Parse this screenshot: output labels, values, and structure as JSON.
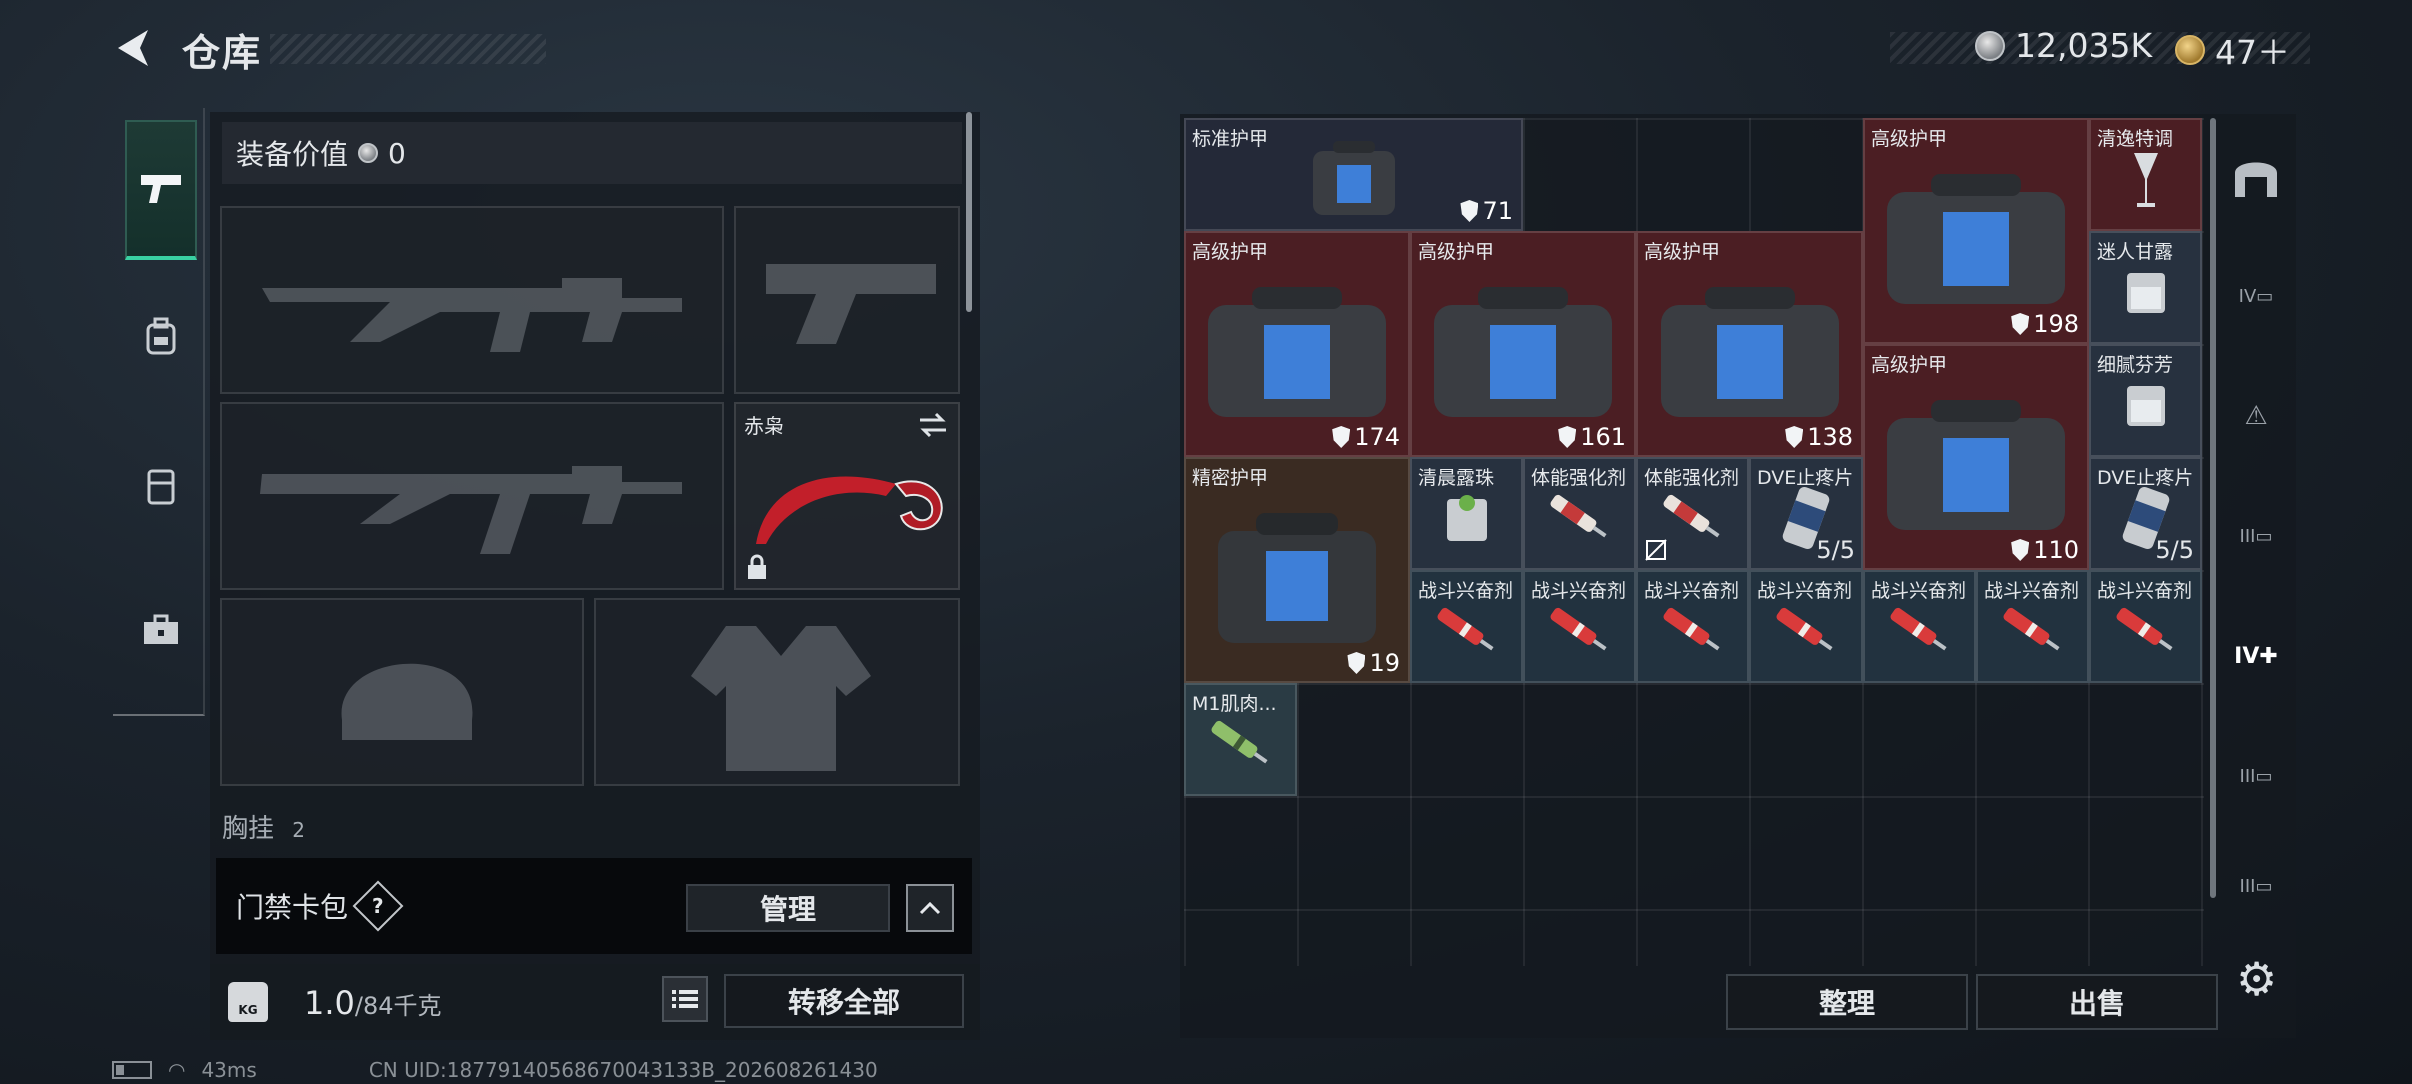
{
  "header": {
    "title": "仓库",
    "currency_silver": "12,035K",
    "currency_gold": "47＋"
  },
  "equipment": {
    "value_label": "装备价值",
    "value": "0",
    "melee_name": "赤枭",
    "chest_label": "胸挂",
    "chest_count": "2",
    "access_card_label": "门禁卡包",
    "help": "?",
    "manage_label": "管理",
    "weight_value": "1.0",
    "weight_max": "/84千克",
    "kg_label": "KG",
    "transfer_label": "转移全部"
  },
  "stash": {
    "items": [
      {
        "name": "标准护甲",
        "durability": "71"
      },
      {
        "name": "高级护甲",
        "durability": "198"
      },
      {
        "name": "清逸特调"
      },
      {
        "name": "高级护甲",
        "durability": "174"
      },
      {
        "name": "高级护甲",
        "durability": "161"
      },
      {
        "name": "高级护甲",
        "durability": "138"
      },
      {
        "name": "迷人甘露"
      },
      {
        "name": "高级护甲",
        "durability": "110"
      },
      {
        "name": "细腻芬芳"
      },
      {
        "name": "精密护甲",
        "durability": "19"
      },
      {
        "name": "清晨露珠"
      },
      {
        "name": "体能强化剂"
      },
      {
        "name": "体能强化剂"
      },
      {
        "name": "DVE止疼片",
        "count": "5/5"
      },
      {
        "name": "DVE止疼片",
        "count": "5/5"
      },
      {
        "name": "战斗兴奋剂"
      },
      {
        "name": "M1肌肉..."
      }
    ],
    "sort_label": "整理",
    "sell_label": "出售"
  },
  "status": {
    "ping": "43ms",
    "uid": "CN UID:18779140568670043133B_202608261430"
  },
  "icons": {
    "back": "back-arrow-icon",
    "pistol": "pistol-icon",
    "backpack": "backpack-icon",
    "rig": "chest-rig-icon",
    "case": "case-icon",
    "settings": "gear-icon"
  },
  "colors": {
    "accent": "#39d0a2",
    "high_armor": "#4b1e23",
    "standard_armor": "#242938",
    "precision_armor": "#3a2b22"
  }
}
